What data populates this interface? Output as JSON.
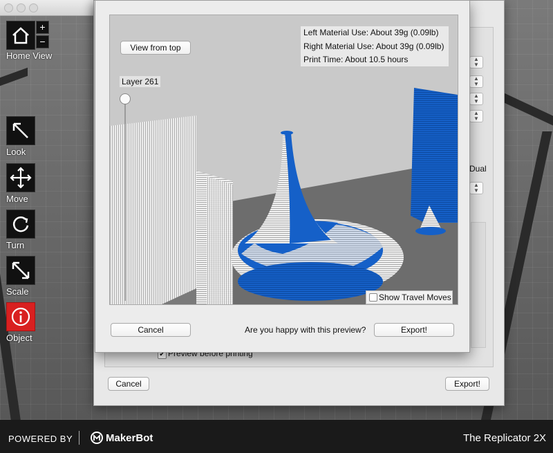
{
  "toolbar": {
    "home_view_label": "Home View",
    "zoom_in": "+",
    "zoom_out": "−",
    "tools": [
      {
        "label": "Look",
        "icon": "arrow-diagonal-icon"
      },
      {
        "label": "Move",
        "icon": "move-arrows-icon"
      },
      {
        "label": "Turn",
        "icon": "rotate-icon"
      },
      {
        "label": "Scale",
        "icon": "scale-arrows-icon"
      },
      {
        "label": "Object",
        "icon": "info-icon"
      }
    ]
  },
  "footer": {
    "powered_by": "POWERED BY",
    "brand": "MakerBot",
    "printer": "The Replicator 2X"
  },
  "settings_dialog": {
    "dual_label": "Dual",
    "preview_checkbox_label": "Preview before printing",
    "preview_checked": true,
    "cancel_label": "Cancel",
    "export_label": "Export!"
  },
  "preview_dialog": {
    "view_from_top_label": "View from top",
    "layer_label": "Layer 261",
    "stats": {
      "left_material": "Left Material Use: About 39g (0.09lb)",
      "right_material": "Right Material Use: About 39g (0.09lb)",
      "print_time": "Print Time: About 10.5 hours"
    },
    "show_travel_moves_label": "Show Travel Moves",
    "show_travel_moves_checked": false,
    "question": "Are you happy with this preview?",
    "cancel_label": "Cancel",
    "export_label": "Export!"
  },
  "colors": {
    "filament_blue": "#1560c8",
    "object_red": "#d92020"
  }
}
